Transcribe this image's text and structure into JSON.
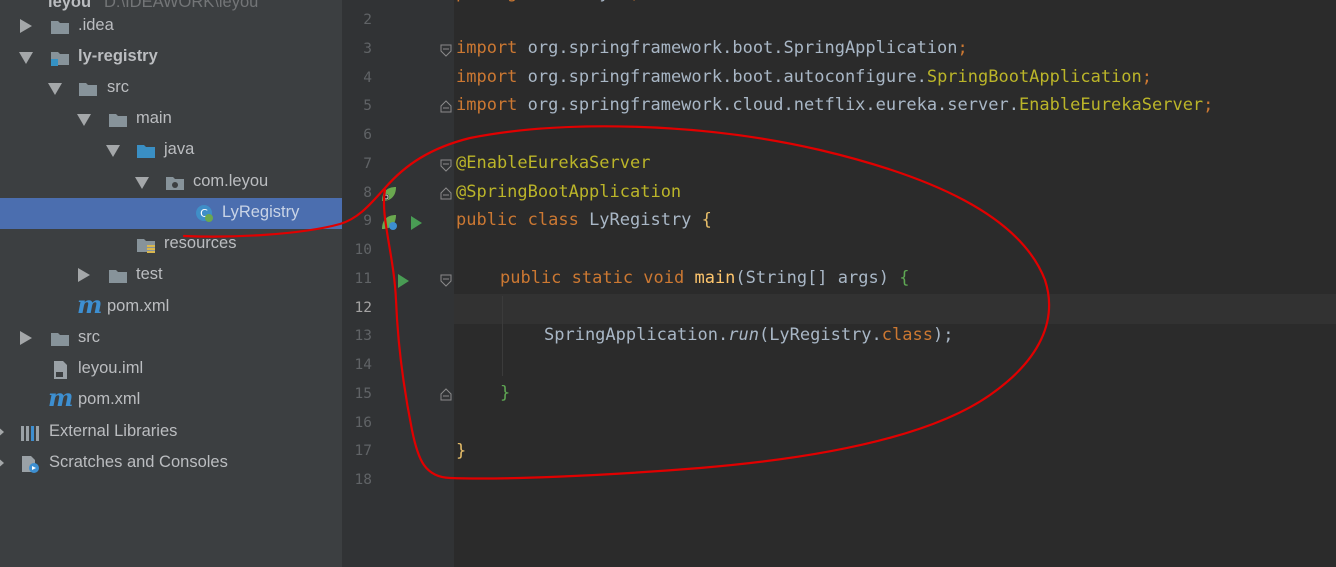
{
  "tree": {
    "root_partial": "leyou",
    "root_path_partial": "D:\\IDEAWORK\\leyou",
    "items": [
      {
        "label": ".idea"
      },
      {
        "label": "ly-registry"
      },
      {
        "label": "src"
      },
      {
        "label": "main"
      },
      {
        "label": "java"
      },
      {
        "label": "com.leyou"
      },
      {
        "label": "LyRegistry"
      },
      {
        "label": "resources"
      },
      {
        "label": "test"
      },
      {
        "label": "pom.xml"
      },
      {
        "label": "src"
      },
      {
        "label": "leyou.iml"
      },
      {
        "label": "pom.xml"
      },
      {
        "label": "External Libraries"
      },
      {
        "label": "Scratches and Consoles"
      }
    ]
  },
  "editor": {
    "line_numbers": [
      "2",
      "3",
      "4",
      "5",
      "6",
      "7",
      "8",
      "9",
      "10",
      "11",
      "12",
      "13",
      "14",
      "15",
      "16",
      "17",
      "18"
    ],
    "current_line": "12",
    "code": {
      "l1": "package com.leyou;",
      "import_kw": "import",
      "imp3_pkg": " org.springframework.boot.SpringApplication",
      "imp4_pkg": " org.springframework.boot.autoconfigure.",
      "imp4_cls": "SpringBootApplication",
      "imp5_pkg": " org.springframework.cloud.netflix.eureka.server.",
      "imp5_cls": "EnableEurekaServer",
      "semicolon": ";",
      "ann1": "@EnableEurekaServer",
      "ann2": "@SpringBootApplication",
      "kw_public_class": "public class",
      "class_name": " LyRegistry ",
      "open_brace": "{",
      "kw_psv": "public static void",
      "method_name": " main",
      "params": "(String[] args) ",
      "call_obj": "SpringApplication.",
      "call_method": "run",
      "call_arg": "(LyRegistry.",
      "kw_class": "class",
      "call_end": ");",
      "close_brace": "}"
    }
  },
  "colors": {
    "annotation_stroke": "#e10000"
  }
}
